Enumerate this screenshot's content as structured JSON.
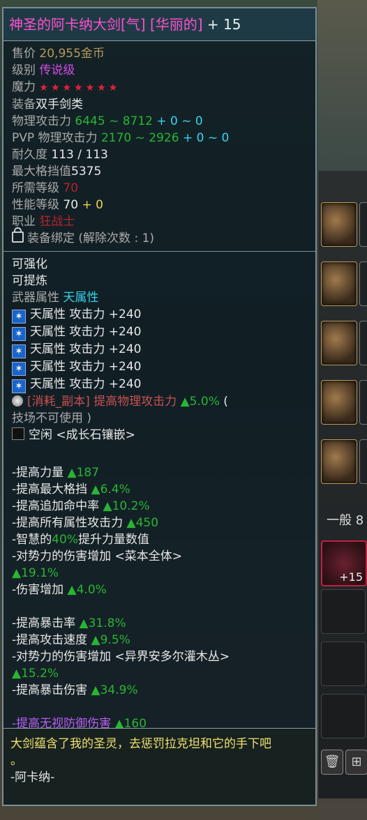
{
  "title": {
    "name": "神圣的阿卡纳大剑[气] [华丽的]",
    "plus": " + 15"
  },
  "info": {
    "price_label": "售价",
    "price_value": "20,955金币",
    "grade_label": "级别",
    "grade_value": "传说级",
    "magic_label": "魔力",
    "magic_stars": "★★★★★★★",
    "equip_label": "装备",
    "equip_value": "双手剑类",
    "patk_label": "物理攻击力",
    "patk_range": "6445 ~ 8712",
    "patk_bonus": " + 0 ~ 0",
    "pvp_label": "PVP 物理攻击力",
    "pvp_range": "2170 ~ 2926",
    "pvp_bonus": " + 0 ~ 0",
    "dur_label": "耐久度",
    "dur_value": "113 / 113",
    "block_label": "最大格挡值",
    "block_value": "5375",
    "req_label": "所需等级",
    "req_value": "70",
    "perf_label": "性能等级",
    "perf_value": "70",
    "perf_bonus": " + 0",
    "class_label": "职业",
    "class_value": "狂战士",
    "bind_text": "装备绑定 (解除次数 : 1)"
  },
  "props": {
    "enhance": "可强化",
    "refine": "可提炼",
    "weapon_attr_label": "武器属性",
    "weapon_attr_value": "天属性",
    "element_lines": [
      "天属性 攻击力 +240",
      "天属性 攻击力 +240",
      "天属性 攻击力 +240",
      "天属性 攻击力 +240",
      "天属性 攻击力 +240"
    ],
    "consume_tag": "[消耗_副本]",
    "consume_text": " 提高物理攻击力 ",
    "consume_value": "▲5.0%",
    "consume_tail": " (",
    "consume_line2": "技场不可使用 )",
    "idle_text": "空闲 <成长石镶嵌>"
  },
  "stats": {
    "s1_label": "-提高力量 ",
    "s1_value": "▲187",
    "s2_label": "-提高最大格挡 ",
    "s2_value": "▲6.4%",
    "s3_label": "-提高追加命中率 ",
    "s3_value": "▲10.2%",
    "s4_label": "-提高所有属性攻击力 ",
    "s4_value": "▲450",
    "s5_a": "-智慧的",
    "s5_b": "40%",
    "s5_c": "提升力量数值",
    "s6_label": "-对势力的伤害增加  <菜本全体>",
    "s6_value": "▲19.1%",
    "s7_label": "-伤害增加 ",
    "s7_value": "▲4.0%",
    "s8_label": "-提高暴击率 ",
    "s8_value": "▲31.8%",
    "s9_label": "-提高攻击速度 ",
    "s9_value": "▲9.5%",
    "s10_label": "-对势力的伤害增加  <异界安多尔灌木丛>",
    "s10_value": "▲15.2%",
    "s11_label": "-提高暴击伤害 ",
    "s11_value": "▲34.9%",
    "s12_label": "-提高无视防御伤害  ",
    "s12_value": "▲160"
  },
  "footer": {
    "quote": "大剑蕴含了我的圣灵，去惩罚拉克坦和它的手下吧",
    "quote_end": "。",
    "signature": "-阿卡纳-"
  },
  "background": {
    "tab_label": "一般 8",
    "item_plus": "+15"
  },
  "colors": {
    "title": "#ff4fcf",
    "legendary": "#d24ce4",
    "green": "#29b533",
    "cyan": "#38d4ee",
    "yellow": "#f2d24a",
    "red": "#e8203a"
  }
}
